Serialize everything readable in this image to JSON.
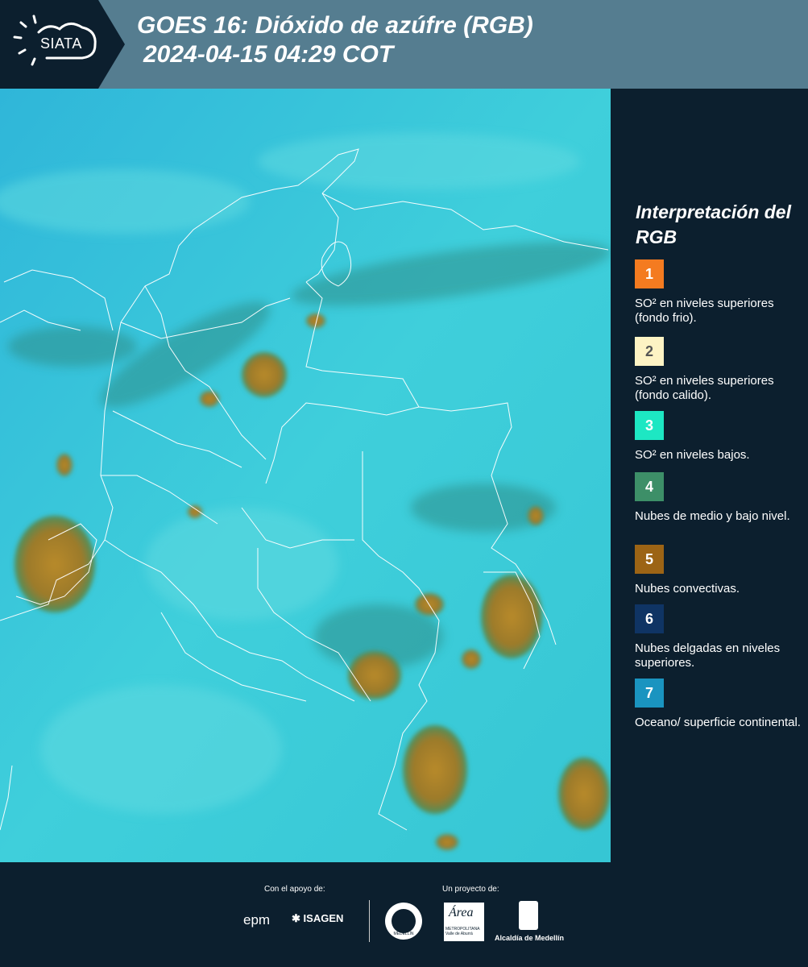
{
  "header": {
    "logo_text": "SIATA",
    "title_line1": "GOES 16: Dióxido de azúfre (RGB)",
    "title_line2": "2024-04-15 04:29 COT",
    "logo_icon": "sun-cloud-icon"
  },
  "legend": {
    "title": "Interpretación del RGB",
    "items": [
      {
        "num": "1",
        "label": "SO² en niveles superiores (fondo frio).",
        "color": "#f47b20",
        "text_color": "#ffffff"
      },
      {
        "num": "2",
        "label": "SO² en niveles superiores (fondo calido).",
        "color": "#fdf3c4",
        "text_color": "#555555"
      },
      {
        "num": "3",
        "label": "SO² en niveles bajos.",
        "color": "#1de7c3",
        "text_color": "#ffffff"
      },
      {
        "num": "4",
        "label": "Nubes de medio y bajo nivel.",
        "color": "#3d8f68",
        "text_color": "#ffffff"
      },
      {
        "num": "5",
        "label": "Nubes convectivas.",
        "color": "#9c6415",
        "text_color": "#ffffff"
      },
      {
        "num": "6",
        "label": "Nubes delgadas en niveles superiores.",
        "color": "#0f3464",
        "text_color": "#ffffff"
      },
      {
        "num": "7",
        "label": "Oceano/ superficie continental.",
        "color": "#1a94c0",
        "text_color": "#ffffff"
      }
    ]
  },
  "footer": {
    "support_label": "Con el apoyo de:",
    "project_label": "Un proyecto de:",
    "sponsor1": "epm",
    "sponsor2": "ISAGEN",
    "partner1_text": "MEDELLÍN",
    "partner2_text": "Área",
    "partner2_sub": "METROPOLITANA Valle de Aburrá",
    "partner3_text": "Alcaldía de Medellín"
  }
}
